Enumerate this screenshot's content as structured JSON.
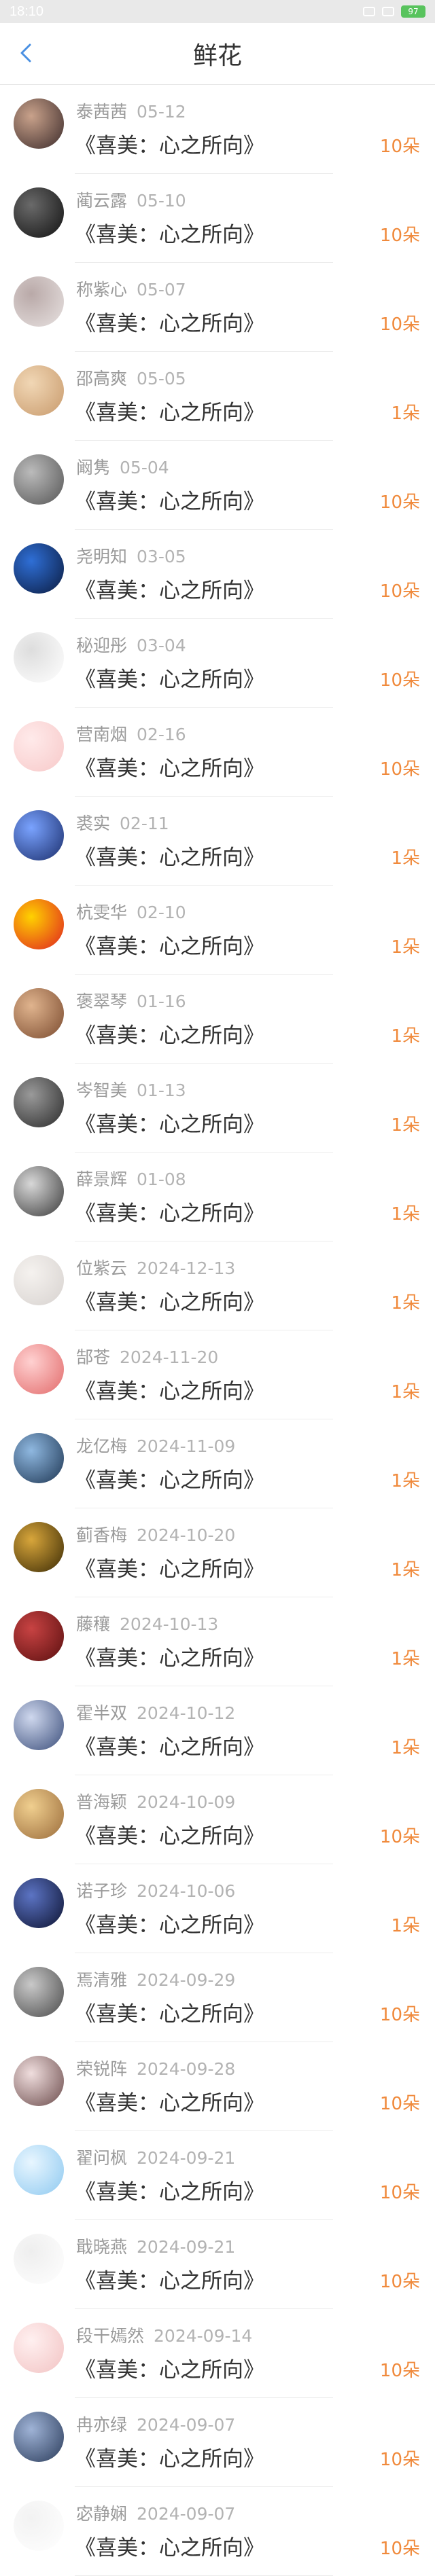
{
  "status_bar": {
    "time": "18:10",
    "battery": "97"
  },
  "header": {
    "title": "鲜花",
    "back_icon": "chevron-left-icon"
  },
  "colors": {
    "accent": "#f08a3c",
    "back": "#4a90e2"
  },
  "items": [
    {
      "name": "泰茜茜",
      "date": "05-12",
      "book": "《喜美：心之所向》",
      "count": "10朵",
      "avatar": [
        "#3b2a2a",
        "#c9a28b"
      ]
    },
    {
      "name": "蔺云露",
      "date": "05-10",
      "book": "《喜美：心之所向》",
      "count": "10朵",
      "avatar": [
        "#111111",
        "#6a6a6a"
      ]
    },
    {
      "name": "称紫心",
      "date": "05-07",
      "book": "《喜美：心之所向》",
      "count": "10朵",
      "avatar": [
        "#e7e1e0",
        "#b9a9a8"
      ]
    },
    {
      "name": "邵高爽",
      "date": "05-05",
      "book": "《喜美：心之所向》",
      "count": "1朵",
      "avatar": [
        "#c89a6c",
        "#f1d7b5"
      ]
    },
    {
      "name": "阚隽",
      "date": "05-04",
      "book": "《喜美：心之所向》",
      "count": "10朵",
      "avatar": [
        "#555555",
        "#bbbbbb"
      ]
    },
    {
      "name": "尧明知",
      "date": "03-05",
      "book": "《喜美：心之所向》",
      "count": "10朵",
      "avatar": [
        "#0b1b3f",
        "#2f6fd6"
      ]
    },
    {
      "name": "秘迎彤",
      "date": "03-04",
      "book": "《喜美：心之所向》",
      "count": "10朵",
      "avatar": [
        "#ffffff",
        "#dddddd"
      ]
    },
    {
      "name": "营南烟",
      "date": "02-16",
      "book": "《喜美：心之所向》",
      "count": "10朵",
      "avatar": [
        "#f7c9c9",
        "#ffeaea"
      ]
    },
    {
      "name": "裘实",
      "date": "02-11",
      "book": "《喜美：心之所向》",
      "count": "1朵",
      "avatar": [
        "#1a2d6b",
        "#7aa3ff"
      ]
    },
    {
      "name": "杭雯华",
      "date": "02-10",
      "book": "《喜美：心之所向》",
      "count": "1朵",
      "avatar": [
        "#e02020",
        "#ffd200"
      ]
    },
    {
      "name": "褒翠琴",
      "date": "01-16",
      "book": "《喜美：心之所向》",
      "count": "1朵",
      "avatar": [
        "#7a4a2e",
        "#e0b48e"
      ]
    },
    {
      "name": "岑智美",
      "date": "01-13",
      "book": "《喜美：心之所向》",
      "count": "1朵",
      "avatar": [
        "#2a2a2a",
        "#9a9a9a"
      ]
    },
    {
      "name": "薛景辉",
      "date": "01-08",
      "book": "《喜美：心之所向》",
      "count": "1朵",
      "avatar": [
        "#3a3a3a",
        "#d8d8d8"
      ]
    },
    {
      "name": "位紫云",
      "date": "2024-12-13",
      "book": "《喜美：心之所向》",
      "count": "1朵",
      "avatar": [
        "#d7d2cf",
        "#f5f2ef"
      ]
    },
    {
      "name": "郜苍",
      "date": "2024-11-20",
      "book": "《喜美：心之所向》",
      "count": "1朵",
      "avatar": [
        "#e26a6a",
        "#ffd1d1"
      ]
    },
    {
      "name": "龙亿梅",
      "date": "2024-11-09",
      "book": "《喜美：心之所向》",
      "count": "1朵",
      "avatar": [
        "#1d3552",
        "#8fb8e0"
      ]
    },
    {
      "name": "蓟香梅",
      "date": "2024-10-20",
      "book": "《喜美：心之所向》",
      "count": "1朵",
      "avatar": [
        "#3a2a05",
        "#d8a63b"
      ]
    },
    {
      "name": "藤穰",
      "date": "2024-10-13",
      "book": "《喜美：心之所向》",
      "count": "1朵",
      "avatar": [
        "#5a0f0f",
        "#c84343"
      ]
    },
    {
      "name": "霍半双",
      "date": "2024-10-12",
      "book": "《喜美：心之所向》",
      "count": "1朵",
      "avatar": [
        "#3a4d7a",
        "#cfd8ee"
      ]
    },
    {
      "name": "普海颖",
      "date": "2024-10-09",
      "book": "《喜美：心之所向》",
      "count": "10朵",
      "avatar": [
        "#9a6b3a",
        "#f0cf8f"
      ]
    },
    {
      "name": "诺子珍",
      "date": "2024-10-06",
      "book": "《喜美：心之所向》",
      "count": "1朵",
      "avatar": [
        "#0c1230",
        "#5c74c4"
      ]
    },
    {
      "name": "焉清雅",
      "date": "2024-09-29",
      "book": "《喜美：心之所向》",
      "count": "10朵",
      "avatar": [
        "#4a4a4a",
        "#c9c9c9"
      ]
    },
    {
      "name": "荣锐阵",
      "date": "2024-09-28",
      "book": "《喜美：心之所向》",
      "count": "10朵",
      "avatar": [
        "#6b4b4b",
        "#f0dede"
      ]
    },
    {
      "name": "翟问枫",
      "date": "2024-09-21",
      "book": "《喜美：心之所向》",
      "count": "10朵",
      "avatar": [
        "#8ec9f0",
        "#e8f6ff"
      ]
    },
    {
      "name": "戢晓燕",
      "date": "2024-09-21",
      "book": "《喜美：心之所向》",
      "count": "10朵",
      "avatar": [
        "#ffffff",
        "#eeeeee"
      ]
    },
    {
      "name": "段干嫣然",
      "date": "2024-09-14",
      "book": "《喜美：心之所向》",
      "count": "10朵",
      "avatar": [
        "#f2c3c3",
        "#fff0f0"
      ]
    },
    {
      "name": "冉亦绿",
      "date": "2024-09-07",
      "book": "《喜美：心之所向》",
      "count": "10朵",
      "avatar": [
        "#2a3b5a",
        "#9fb3d6"
      ]
    },
    {
      "name": "宓静娴",
      "date": "2024-09-07",
      "book": "《喜美：心之所向》",
      "count": "10朵",
      "avatar": [
        "#ffffff",
        "#f2f2f2"
      ]
    }
  ]
}
